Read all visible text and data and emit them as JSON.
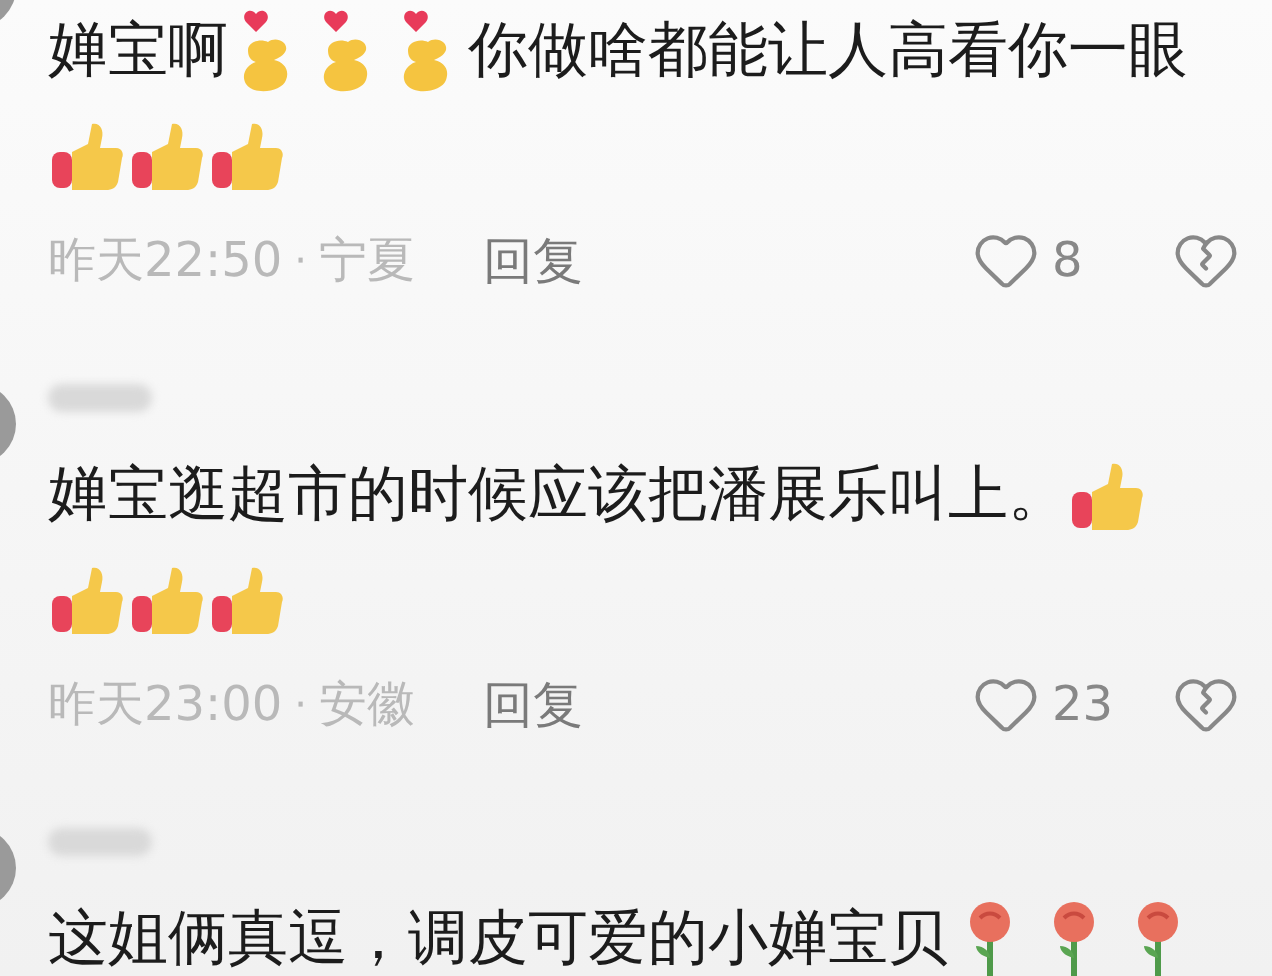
{
  "comments": [
    {
      "name_hidden": false,
      "lines": [
        [
          {
            "kind": "text",
            "text": "婵宝啊"
          },
          {
            "kind": "finger-heart"
          },
          {
            "kind": "finger-heart"
          },
          {
            "kind": "finger-heart"
          },
          {
            "kind": "text",
            "text": "你做啥都能让人高看你一眼"
          }
        ],
        [
          {
            "kind": "thumbs-up"
          },
          {
            "kind": "thumbs-up"
          },
          {
            "kind": "thumbs-up"
          }
        ]
      ],
      "meta": {
        "time": "昨天22:50",
        "separator": "·",
        "location": "宁夏",
        "reply": "回复",
        "likes": "8",
        "liked": false
      }
    },
    {
      "name_hidden": true,
      "lines": [
        [
          {
            "kind": "text",
            "text": "婵宝逛超市的时候应该把潘展乐叫上。"
          },
          {
            "kind": "thumbs-up"
          }
        ],
        [
          {
            "kind": "thumbs-up"
          },
          {
            "kind": "thumbs-up"
          },
          {
            "kind": "thumbs-up"
          }
        ]
      ],
      "meta": {
        "time": "昨天23:00",
        "separator": "·",
        "location": "安徽",
        "reply": "回复",
        "likes": "23",
        "liked": false
      }
    },
    {
      "name_hidden": true,
      "lines": [
        [
          {
            "kind": "text",
            "text": "这姐俩真逗，调皮可爱的小婵宝贝"
          },
          {
            "kind": "rose"
          },
          {
            "kind": "rose"
          },
          {
            "kind": "rose"
          }
        ]
      ]
    }
  ]
}
